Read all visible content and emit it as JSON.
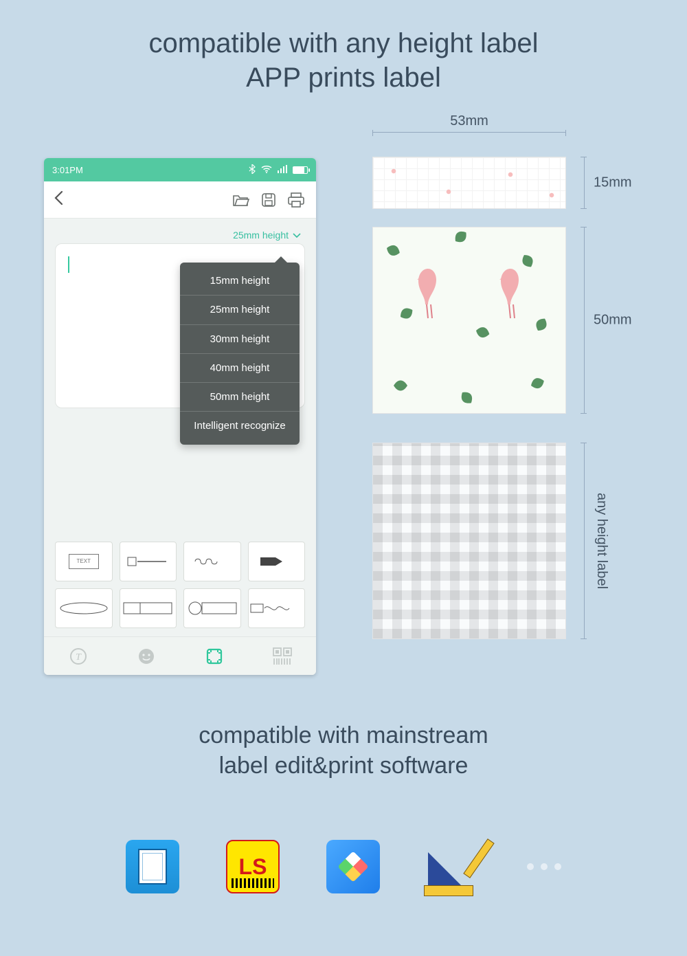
{
  "headline": {
    "line1": "compatible with any height label",
    "line2": "APP prints label"
  },
  "phone": {
    "statusbar": {
      "time": "3:01PM"
    },
    "height_selector": {
      "current": "25mm height"
    },
    "dropdown": {
      "opt1": "15mm height",
      "opt2": "25mm height",
      "opt3": "30mm height",
      "opt4": "40mm height",
      "opt5": "50mm height",
      "opt6": "Intelligent recognize"
    },
    "templates": {
      "t1": "TEXT"
    }
  },
  "samples": {
    "width_label": "53mm",
    "h1": "15mm",
    "h2": "50mm",
    "h3": "any height label"
  },
  "subhead": {
    "line1": "compatible with mainstream",
    "line2": "label edit&print software"
  },
  "apps": {
    "a2": "LS"
  }
}
